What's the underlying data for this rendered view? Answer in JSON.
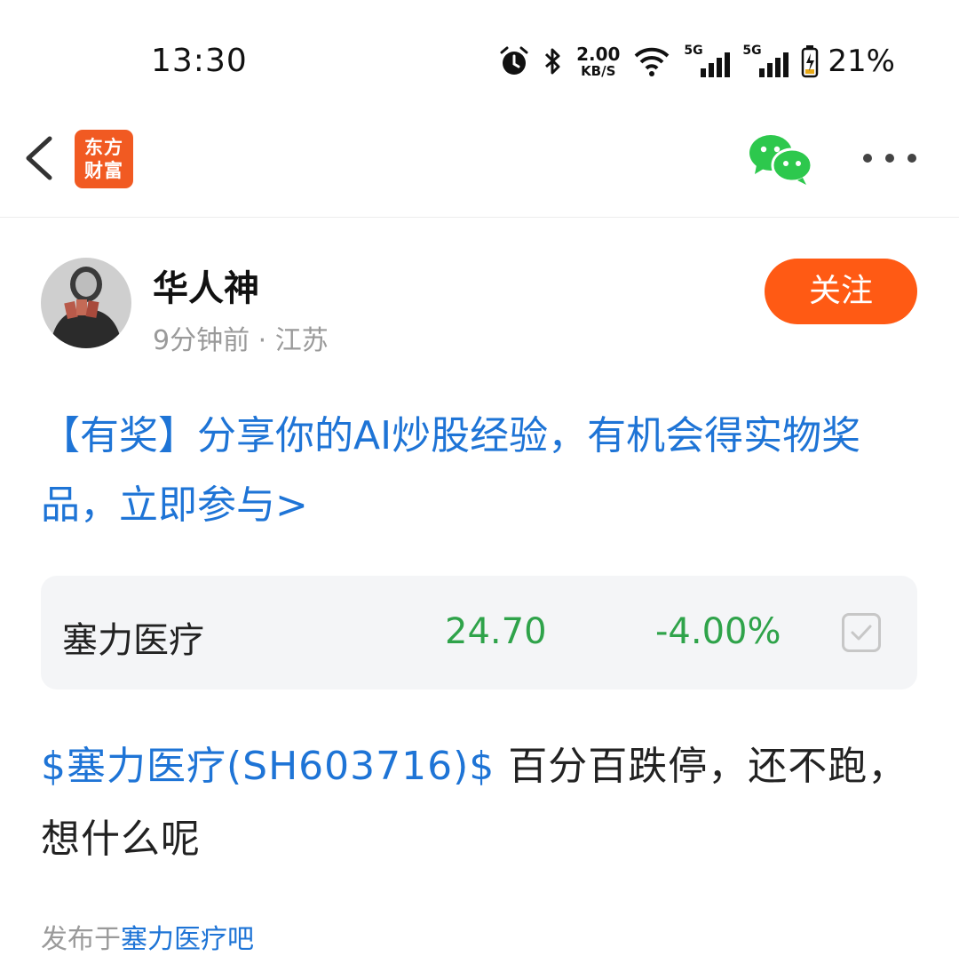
{
  "status_bar": {
    "time": "13:30",
    "net_speed_value": "2.00",
    "net_speed_unit": "KB/S",
    "network_1": "5G",
    "network_2": "5G",
    "battery_percent": "21%",
    "icons": [
      "alarm-icon",
      "bluetooth-icon",
      "wifi-icon",
      "signal-icon",
      "battery-icon"
    ]
  },
  "nav": {
    "logo_line1": "东方",
    "logo_line2": "财富",
    "icons": [
      "back-icon",
      "wechat-icon",
      "more-icon"
    ],
    "brand_color": "#f15a22"
  },
  "author": {
    "name": "华人神",
    "time_ago": "9分钟前",
    "separator": "·",
    "location": "江苏",
    "follow_label": "关注"
  },
  "promo": {
    "text": "【有奖】分享你的AI炒股经验，有机会得实物奖品，立即参与>"
  },
  "stock": {
    "name": "塞力医疗",
    "price": "24.70",
    "change": "-4.00%",
    "change_color": "#2fa34a"
  },
  "post": {
    "stock_tag": "$塞力医疗(SH603716)$",
    "text": " 百分百跌停，还不跑，想什么呢"
  },
  "source": {
    "prefix": "发布于",
    "bar_name": "塞力医疗吧"
  },
  "colors": {
    "link_blue": "#1e74d6",
    "follow_orange": "#ff5a14"
  }
}
